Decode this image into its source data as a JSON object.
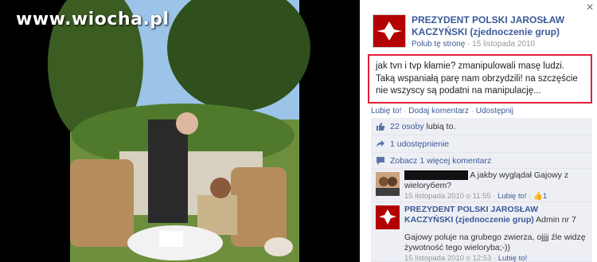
{
  "watermark": "www.wiocha.pl",
  "page": {
    "name": "PREZYDENT POLSKI JAROSŁAW KACZYŃSKI (zjednoczenie grup)",
    "like_label": "Polub tę stronę",
    "date": "15 listopada 2010"
  },
  "post": {
    "text": "jak tvn i tvp kłamie? zmanipulowali masę ludzi. Taką wspaniałą parę nam obrzydzili! na szczęście nie wszyscy są podatni na manipulację...",
    "actions": [
      "Lubię to!",
      "Dodaj komentarz",
      "Udostępnij"
    ]
  },
  "likes": {
    "count_link": "22 osoby",
    "suffix": "lubią to."
  },
  "shares": {
    "label": "1 udostępnienie"
  },
  "more_comments": {
    "label": "Zobacz 1 więcej komentarz"
  },
  "comments": [
    {
      "text": "A jakby wyglądał Gajowy z wieloryбem?",
      "time": "15 listopada 2010 o 11:55",
      "like": "Lubię to!",
      "like_count": "1"
    },
    {
      "author": "PREZYDENT POLSKI JAROSŁAW KACZYŃSKI (zjednoczenie grup)",
      "role": "Admin nr 7",
      "text": "Gajowy poluje na grubego zwierza, ojjjj źle widzę żywotność tego wieloryba;-))",
      "time": "15 listopada 2010 o 12:53",
      "like": "Lubię to!"
    }
  ],
  "icons": {
    "close": "close-icon",
    "thumb": "thumbs-up-icon",
    "share": "share-icon",
    "comment": "comment-icon"
  },
  "colors": {
    "link": "#3b5998",
    "highlight": "#e0203a",
    "panel": "#edeff4"
  }
}
